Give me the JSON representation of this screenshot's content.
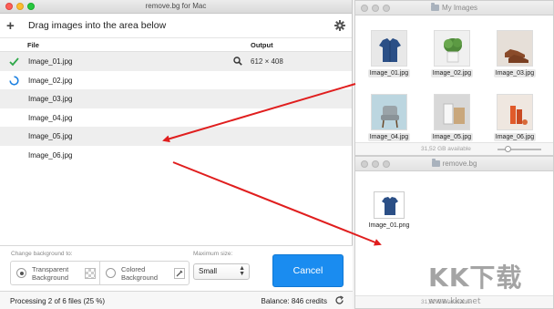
{
  "app": {
    "title": "remove.bg for Mac",
    "drop_hint": "Drag images into the area below",
    "columns": {
      "file": "File",
      "output": "Output"
    },
    "rows": [
      {
        "file": "Image_01.jpg",
        "status": "done",
        "output": "612 × 408"
      },
      {
        "file": "Image_02.jpg",
        "status": "processing",
        "output": ""
      },
      {
        "file": "Image_03.jpg",
        "status": "queued",
        "output": ""
      },
      {
        "file": "Image_04.jpg",
        "status": "queued",
        "output": ""
      },
      {
        "file": "Image_05.jpg",
        "status": "queued",
        "output": ""
      },
      {
        "file": "Image_06.jpg",
        "status": "queued",
        "output": ""
      }
    ],
    "change_bg_label": "Change background to:",
    "option_transparent": "Transparent Background",
    "option_colored": "Colored Background",
    "max_size_label": "Maximum size:",
    "max_size_value": "Small",
    "cancel_label": "Cancel",
    "status_text": "Processing 2 of 6 files (25 %)",
    "balance_text": "Balance: 846 credits",
    "accent_color": "#1a8cf0"
  },
  "finder_images": {
    "title": "My Images",
    "files": [
      "Image_01.jpg",
      "Image_02.jpg",
      "Image_03.jpg",
      "Image_04.jpg",
      "Image_05.jpg",
      "Image_06.jpg"
    ],
    "available": "31,52 GB available"
  },
  "finder_output": {
    "title": "remove.bg",
    "files": [
      "Image_01.png"
    ],
    "available": "31,52 GB available"
  },
  "watermark": {
    "text": "KK下载",
    "url": "www.kkx.net"
  }
}
